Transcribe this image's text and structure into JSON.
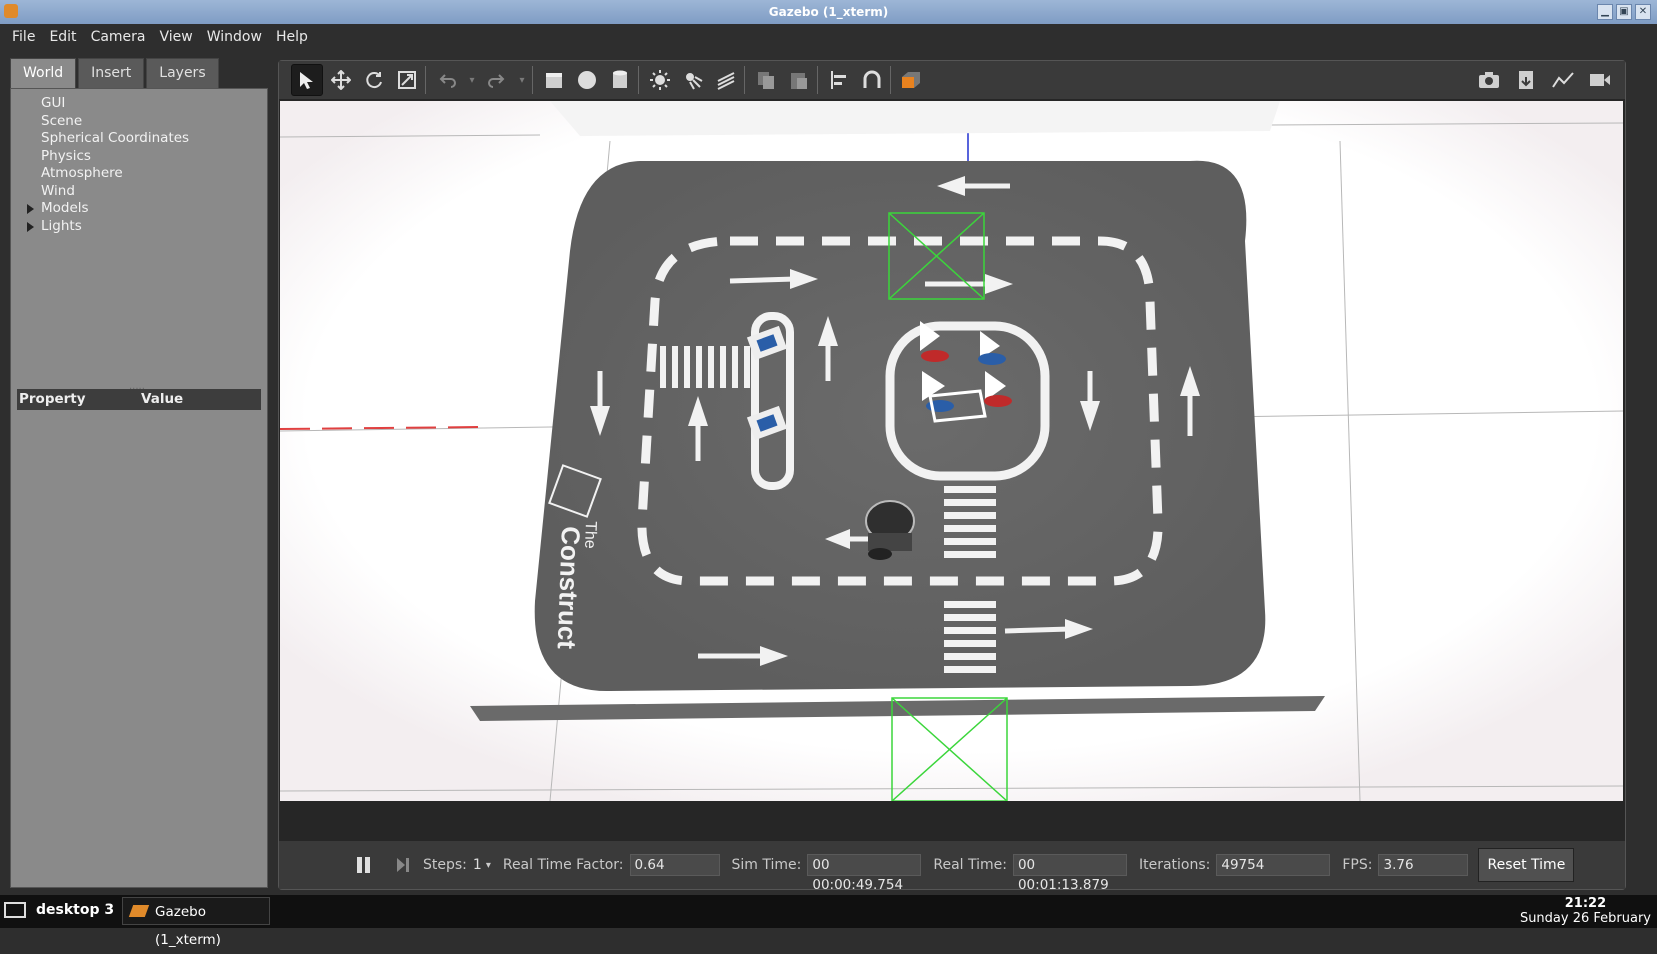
{
  "window": {
    "title": "Gazebo (1_xterm)",
    "buttons": [
      "▁",
      "▣",
      "✕"
    ]
  },
  "menu": [
    "File",
    "Edit",
    "Camera",
    "View",
    "Window",
    "Help"
  ],
  "left_panel": {
    "tabs": [
      "World",
      "Insert",
      "Layers"
    ],
    "tree": [
      {
        "label": "GUI",
        "expandable": false
      },
      {
        "label": "Scene",
        "expandable": false
      },
      {
        "label": "Spherical Coordinates",
        "expandable": false
      },
      {
        "label": "Physics",
        "expandable": false
      },
      {
        "label": "Atmosphere",
        "expandable": false
      },
      {
        "label": "Wind",
        "expandable": false
      },
      {
        "label": "Models",
        "expandable": true
      },
      {
        "label": "Lights",
        "expandable": true
      }
    ],
    "property_header": {
      "property": "Property",
      "value": "Value"
    }
  },
  "toolbar": {
    "tools": [
      "select-arrow-icon",
      "translate-icon",
      "rotate-icon",
      "scale-icon",
      "undo-icon",
      "redo-icon",
      "box-icon",
      "sphere-icon",
      "cylinder-icon",
      "point-light-icon",
      "spot-light-icon",
      "directional-light-icon",
      "copy-icon",
      "paste-icon",
      "align-icon",
      "snap-icon",
      "view-angle-icon"
    ],
    "right_tools": [
      "screenshot-icon",
      "log-icon",
      "plot-icon",
      "record-video-icon"
    ]
  },
  "scene": {
    "brand_text_1": "The",
    "brand_text_2": "Construct"
  },
  "bottom": {
    "steps_label": "Steps:",
    "steps_value": "1",
    "rtf_label": "Real Time Factor:",
    "rtf_value": "0.64",
    "sim_label": "Sim Time:",
    "sim_value": "00 00:00:49.754",
    "real_label": "Real Time:",
    "real_value": "00 00:01:13.879",
    "iter_label": "Iterations:",
    "iter_value": "49754",
    "fps_label": "FPS:",
    "fps_value": "3.76",
    "reset_label": "Reset Time"
  },
  "taskbar": {
    "desktop": "desktop 3",
    "task": "Gazebo (1_xterm)",
    "time": "21:22",
    "date": "Sunday 26 February"
  }
}
